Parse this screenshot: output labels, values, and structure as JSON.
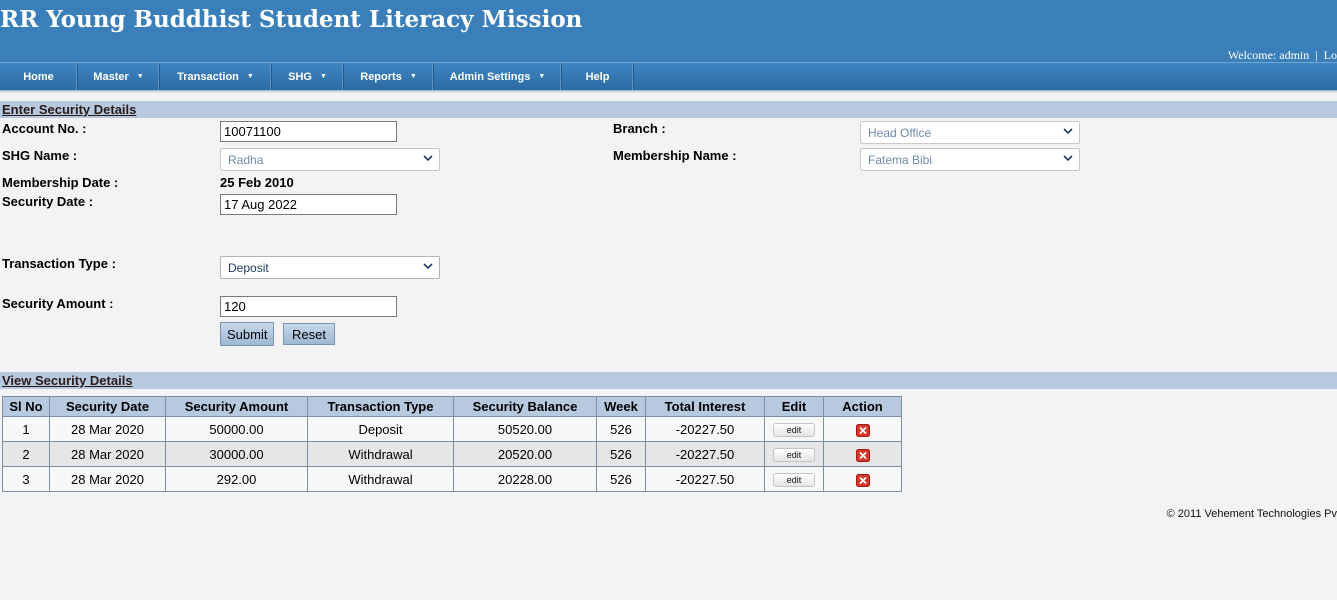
{
  "header": {
    "title": "RR Young Buddhist Student Literacy Mission",
    "welcome_label": "Welcome: admin",
    "separator": "|",
    "logout_label": "Lo"
  },
  "nav": {
    "items": [
      {
        "label": "Home",
        "dropdown": false
      },
      {
        "label": "Master",
        "dropdown": true
      },
      {
        "label": "Transaction",
        "dropdown": true
      },
      {
        "label": "SHG",
        "dropdown": true
      },
      {
        "label": "Reports",
        "dropdown": true
      },
      {
        "label": "Admin Settings",
        "dropdown": true
      },
      {
        "label": "Help",
        "dropdown": false
      }
    ]
  },
  "form": {
    "section_title": "Enter Security Details",
    "account_no_label": "Account No. :",
    "account_no_value": "10071100",
    "branch_label": "Branch :",
    "branch_value": "Head Office",
    "shg_name_label": "SHG Name :",
    "shg_name_value": "Radha",
    "membership_name_label": "Membership Name :",
    "membership_name_value": "Fatema Bibi",
    "membership_date_label": "Membership Date :",
    "membership_date_value": "25 Feb 2010",
    "security_date_label": "Security Date :",
    "security_date_value": "17 Aug 2022",
    "transaction_type_label": "Transaction Type :",
    "transaction_type_value": "Deposit",
    "security_amount_label": "Security Amount :",
    "security_amount_value": "120",
    "submit_label": "Submit",
    "reset_label": "Reset"
  },
  "table": {
    "section_title": "View Security Details",
    "columns": [
      "Sl No",
      "Security Date",
      "Security Amount",
      "Transaction Type",
      "Security Balance",
      "Week",
      "Total Interest",
      "Edit",
      "Action"
    ],
    "edit_label": "edit",
    "rows": [
      {
        "sl": "1",
        "date": "28 Mar 2020",
        "amount": "50000.00",
        "type": "Deposit",
        "balance": "50520.00",
        "week": "526",
        "interest": "-20227.50"
      },
      {
        "sl": "2",
        "date": "28 Mar 2020",
        "amount": "30000.00",
        "type": "Withdrawal",
        "balance": "20520.00",
        "week": "526",
        "interest": "-20227.50"
      },
      {
        "sl": "3",
        "date": "28 Mar 2020",
        "amount": "292.00",
        "type": "Withdrawal",
        "balance": "20228.00",
        "week": "526",
        "interest": "-20227.50"
      }
    ]
  },
  "footer": {
    "copyright": "© 2011 Vehement Technologies Pv"
  },
  "colors": {
    "header_blue": "#3a7fba",
    "section_bar": "#b7c9df",
    "delete_red": "#d9352b"
  },
  "icons": {
    "dropdown": "chevron-down-icon",
    "delete": "delete-icon",
    "nav_caret": "caret-down-icon"
  }
}
